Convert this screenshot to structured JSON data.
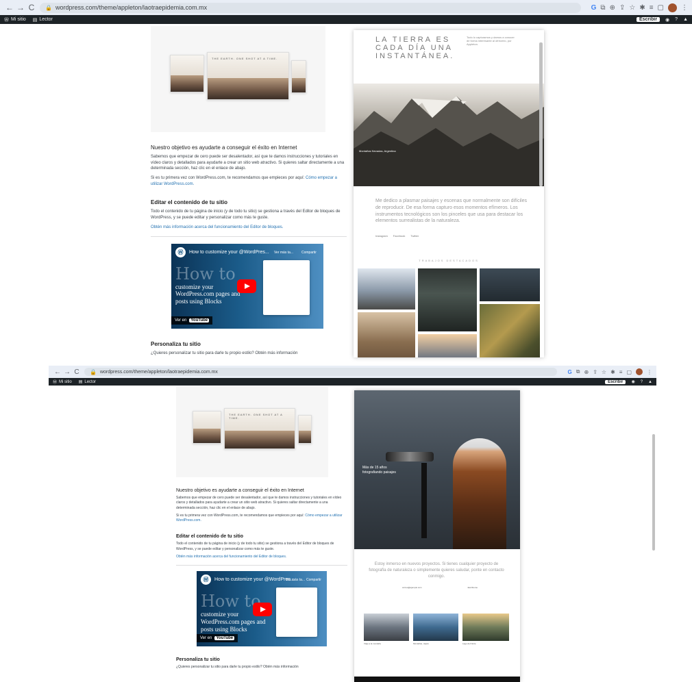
{
  "browser": {
    "url": "wordpress.com/theme/appleton/laotraepidemia.com.mx",
    "back_icon": "←",
    "forward_icon": "→",
    "reload_icon": "C"
  },
  "wpbar": {
    "my_site": "Mi sitio",
    "reader": "Lector",
    "write": "Escribir"
  },
  "left": {
    "device_title": "THE EARTH. ONE SHOT AT A TIME.",
    "heading1": "Nuestro objetivo es ayudarte a conseguir el éxito en Internet",
    "para1": "Sabemos que empezar de cero puede ser desalentador, así que te damos instrucciones y tutoriales en vídeo claros y detallados para ayudarte a crear un sitio web atractivo. Si quieres saltar directamente a una determinada sección, haz clic en el enlace de abajo.",
    "para2_prefix": "Si es tu primera vez con WordPress.com, te recomendamos que empieces por aquí:",
    "para2_link": "Cómo empezar a utilizar WordPress.com.",
    "heading2": "Editar el contenido de tu sitio",
    "para3": "Todo el contenido de tu página de inicio (y de todo tu sitio) se gestiona a través del Editor de bloques de WordPress, y se puede editar y personalizar como más te guste.",
    "link_editor": "Obtén más información acerca del funcionamiento del Editor de bloques.",
    "heading3": "Personaliza tu sitio",
    "para4": "¿Quieres personalizar tu sitio para darle tu propio estilo? Obtén más información"
  },
  "video": {
    "title": "How to customize your @WordPres...",
    "big_text": "How to",
    "subtitle": "customize your WordPress.com pages and posts using Blocks",
    "watch_later": "Ver más ta...",
    "share": "Compartir",
    "watch_on": "Ver en",
    "youtube": "YouTube"
  },
  "preview1": {
    "title": "LA TIERRA ES CADA DÍA UNA INSTANTÁNEA.",
    "side_text": "Todo lo capturamos y damos a conocer de forma interesante al ofrecerlo, por Appleton.",
    "caption": "Montañas Nevadas, Argentina",
    "quote": "Me dedico a plasmar paisajes y escenas que normalmente son difíciles de reproducir. De esa forma capturo esos momentos efímeros. Los instrumentos tecnológicos son los pinceles que usa para destacar los elementos surrealistas de la naturaleza.",
    "social": [
      "Instagram",
      "Facebook",
      "Twitter"
    ],
    "featured": "TRABAJOS DESTACADOS"
  },
  "preview2": {
    "hero_caption": "Más de 15 años fotografiando paisajes",
    "contact": "Estoy inmerso en nuevos proyectos. Si tienes cualquier proyecto de fotografía de naturaleza o simplemente quieres saludar, ponte en contacto conmigo.",
    "links": [
      "correo@ejemplo.com",
      "Escríbeme"
    ],
    "gallery_captions": [
      "Viaje a la montaña",
      "Montañas, Japón",
      "Lago del Norte"
    ]
  },
  "colors": {
    "chrome": "#e9eef6",
    "wpbar": "#1d2327",
    "link": "#2271b1",
    "youtube_red": "#ff0000"
  }
}
